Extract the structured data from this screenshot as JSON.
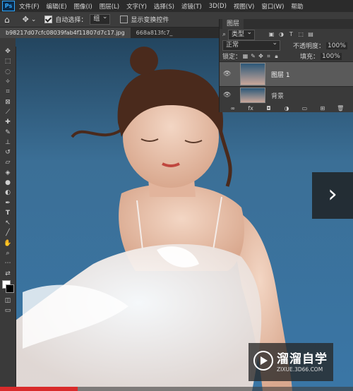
{
  "app": {
    "logo": "Ps"
  },
  "menubar": {
    "items": [
      "文件(F)",
      "编辑(E)",
      "图像(I)",
      "图层(L)",
      "文字(Y)",
      "选择(S)",
      "滤镜(T)",
      "3D(D)",
      "视图(V)",
      "窗口(W)",
      "帮助"
    ]
  },
  "options": {
    "auto_select_label": "自动选择：",
    "auto_select_value": "组",
    "show_transform_label": "显示变换控件"
  },
  "tabs": [
    {
      "label": "b98217d07cfc08039fab4f11807d7c17.jpg"
    },
    {
      "label": "668a813fc7_"
    }
  ],
  "layers_panel": {
    "title": "图层",
    "kind_filter": "类型",
    "blend_mode": "正常",
    "opacity_label": "不透明度：",
    "opacity_value": "100%",
    "lock_label": "锁定：",
    "fill_label": "填充：",
    "fill_value": "100%",
    "layers": [
      {
        "name": "图层 1"
      },
      {
        "name": "背景"
      }
    ]
  },
  "watermark": {
    "brand": "溜溜自学",
    "url": "ZIXUE.3D66.COM"
  },
  "progress": {
    "fraction": 0.22
  },
  "colors": {
    "accent": "#31a8ff",
    "progress": "#d92b2b"
  }
}
